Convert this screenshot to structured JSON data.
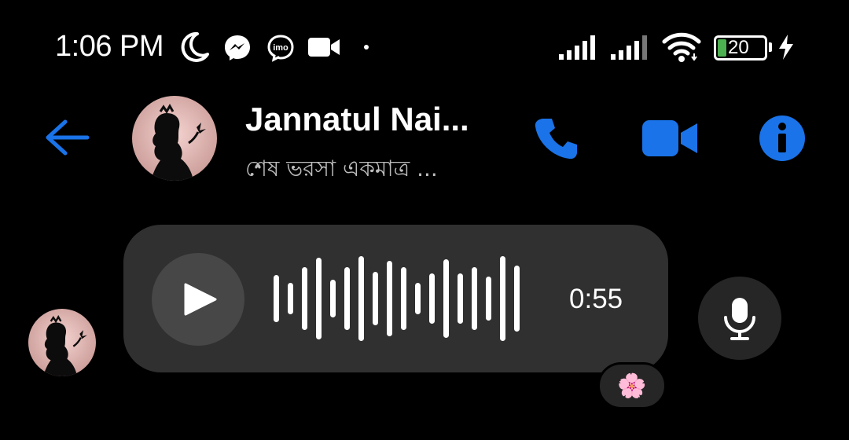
{
  "status_bar": {
    "time": "1:06 PM",
    "icons": [
      "moon-icon",
      "messenger-icon",
      "imo-icon",
      "video-camera-icon",
      "dot-icon"
    ],
    "imo_label": "imo",
    "battery_level": "20",
    "battery_level_fraction": 0.2
  },
  "header": {
    "contact_name": "Jannatul Nai...",
    "contact_status": "শেষ ভরসা একমাত্র ...",
    "actions": [
      "back-arrow-icon",
      "phone-call-icon",
      "video-call-icon",
      "info-icon"
    ]
  },
  "message": {
    "type": "voice",
    "duration": "0:55",
    "reaction_emoji": "🌸"
  },
  "colors": {
    "accent": "#1a73e8",
    "bubble": "#303030",
    "play_button": "#474747",
    "background": "#000000"
  }
}
